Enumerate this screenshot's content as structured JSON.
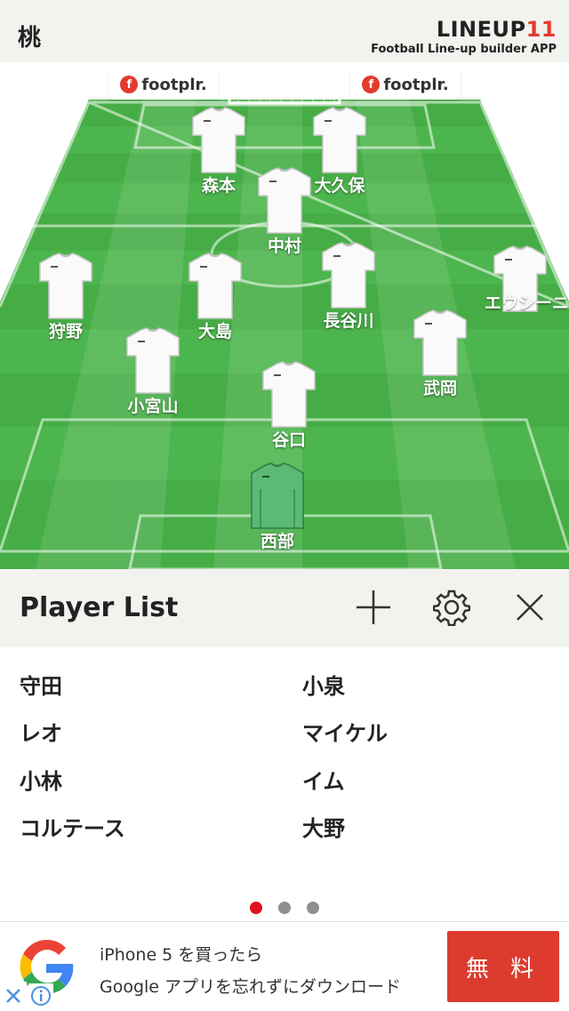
{
  "header": {
    "team_name": "桃",
    "brand_logo_text": "LINEUP",
    "brand_logo_number": "11",
    "brand_subtitle": "Football Line-up builder APP"
  },
  "sponsors": [
    {
      "name": "footplr."
    },
    {
      "name": "footplr."
    }
  ],
  "players": [
    {
      "name": "森本",
      "role": "field"
    },
    {
      "name": "大久保",
      "role": "field"
    },
    {
      "name": "中村",
      "role": "field"
    },
    {
      "name": "狩野",
      "role": "field"
    },
    {
      "name": "大島",
      "role": "field"
    },
    {
      "name": "長谷川",
      "role": "field"
    },
    {
      "name": "エウシーニ",
      "role": "field"
    },
    {
      "name": "小宮山",
      "role": "field"
    },
    {
      "name": "武岡",
      "role": "field"
    },
    {
      "name": "谷口",
      "role": "field"
    },
    {
      "name": "西部",
      "role": "goalkeeper"
    }
  ],
  "player_list": {
    "title": "Player List",
    "add_icon": "plus-icon",
    "settings_icon": "gear-icon",
    "close_icon": "close-icon",
    "items": [
      "守田",
      "小泉",
      "レオ",
      "マイケル",
      "小林",
      "イム",
      "コルテース",
      "大野"
    ]
  },
  "pagination": {
    "pages": 3,
    "current": 1
  },
  "colors": {
    "accent": "#e0101e",
    "pitch_dark": "#3aa03a",
    "pitch_light": "#5cc45c",
    "goalkeeper_kit": "#5bba74",
    "ad_button": "#dc3b2e"
  },
  "ad": {
    "line1": "iPhone 5 を買ったら",
    "line2": "Google アプリを忘れずにダウンロード",
    "button": "無 料"
  }
}
